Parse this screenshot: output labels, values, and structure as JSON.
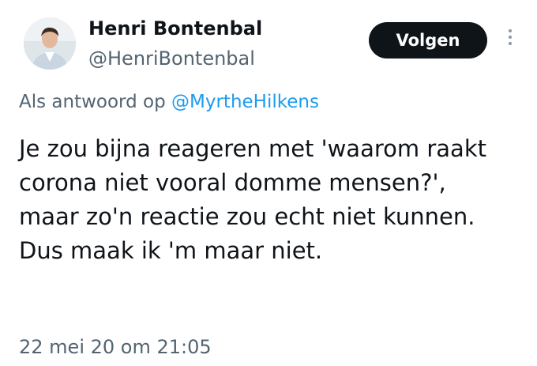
{
  "author": {
    "display_name": "Henri Bontenbal",
    "handle": "@HenriBontenbal"
  },
  "follow_button_label": "Volgen",
  "reply": {
    "prefix": "Als antwoord op ",
    "mention": "@MyrtheHilkens"
  },
  "tweet_text": "Je zou bijna reageren met 'waarom raakt corona niet vooral domme mensen?', maar zo'n reactie zou echt niet kunnen. Dus maak ik 'm maar niet.",
  "timestamp": "22 mei 20 om 21:05",
  "colors": {
    "text": "#0f1419",
    "secondary": "#536471",
    "link": "#1d9bf0",
    "button_bg": "#0f1419"
  }
}
